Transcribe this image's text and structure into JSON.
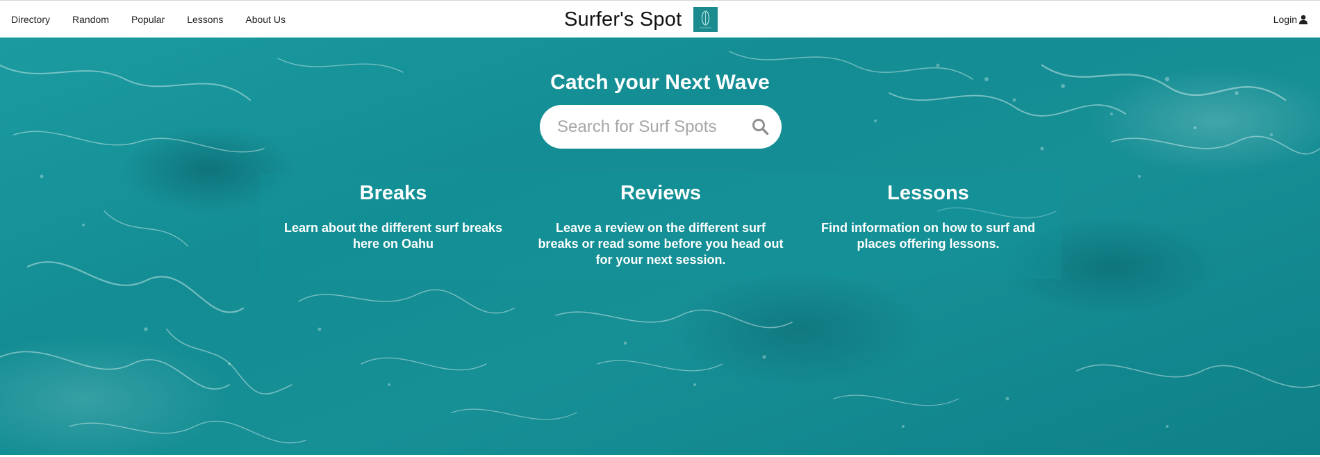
{
  "nav": {
    "links": [
      "Directory",
      "Random",
      "Popular",
      "Lessons",
      "About Us"
    ],
    "brand_title": "Surfer's Spot",
    "login_label": "Login"
  },
  "hero": {
    "title": "Catch your Next Wave",
    "search_placeholder": "Search for Surf Spots",
    "cards": [
      {
        "title": "Breaks",
        "text": "Learn about the different surf breaks here on Oahu"
      },
      {
        "title": "Reviews",
        "text": "Leave a review on the different surf breaks or read some before you head out for your next session."
      },
      {
        "title": "Lessons",
        "text": "Find information on how to surf and places offering lessons."
      }
    ]
  },
  "colors": {
    "ocean_teal": "#168f95",
    "logo_teal": "#1a8a8e",
    "nav_background": "#ffffff",
    "text_white": "#ffffff"
  },
  "icons": {
    "logo": "surfboard-logo-icon",
    "login": "user-icon",
    "search": "search-icon"
  }
}
